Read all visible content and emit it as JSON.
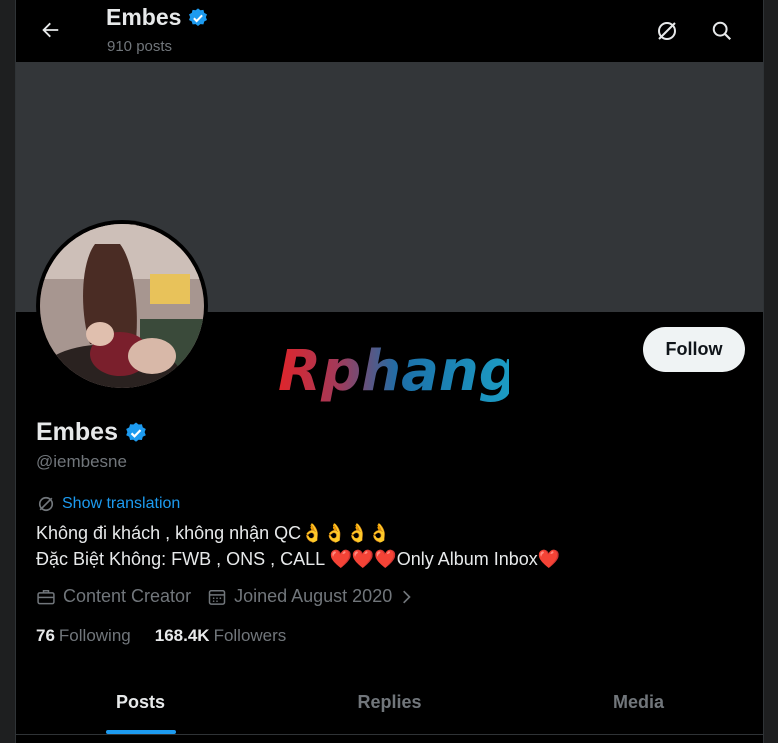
{
  "header": {
    "name": "Embes",
    "posts": "910 posts"
  },
  "watermark": "Rphang",
  "profile": {
    "name": "Embes",
    "handle": "@iembesne",
    "follow_label": "Follow",
    "translation_label": "Show translation",
    "bio_line1": "Không đi khách , không nhận QC",
    "bio_line1_emoji": "👌👌👌👌",
    "bio_line2_a": "Đặc Biệt Không: FWB , ONS , CALL ",
    "bio_line2_hearts": "❤️❤️❤️",
    "bio_line2_b": "Only Album Inbox",
    "bio_line2_heart": "❤️",
    "category": "Content Creator",
    "joined": "Joined August 2020",
    "following_count": "76",
    "following_label": "Following",
    "followers_count": "168.4K",
    "followers_label": "Followers"
  },
  "tabs": [
    "Posts",
    "Replies",
    "Media"
  ],
  "colors": {
    "accent": "#1d9bf0",
    "banner": "#333639",
    "muted": "#71767b"
  },
  "icons": [
    "back-arrow-icon",
    "verified-badge-icon",
    "translate-icon",
    "search-icon",
    "briefcase-icon",
    "calendar-icon",
    "chevron-right-icon"
  ]
}
